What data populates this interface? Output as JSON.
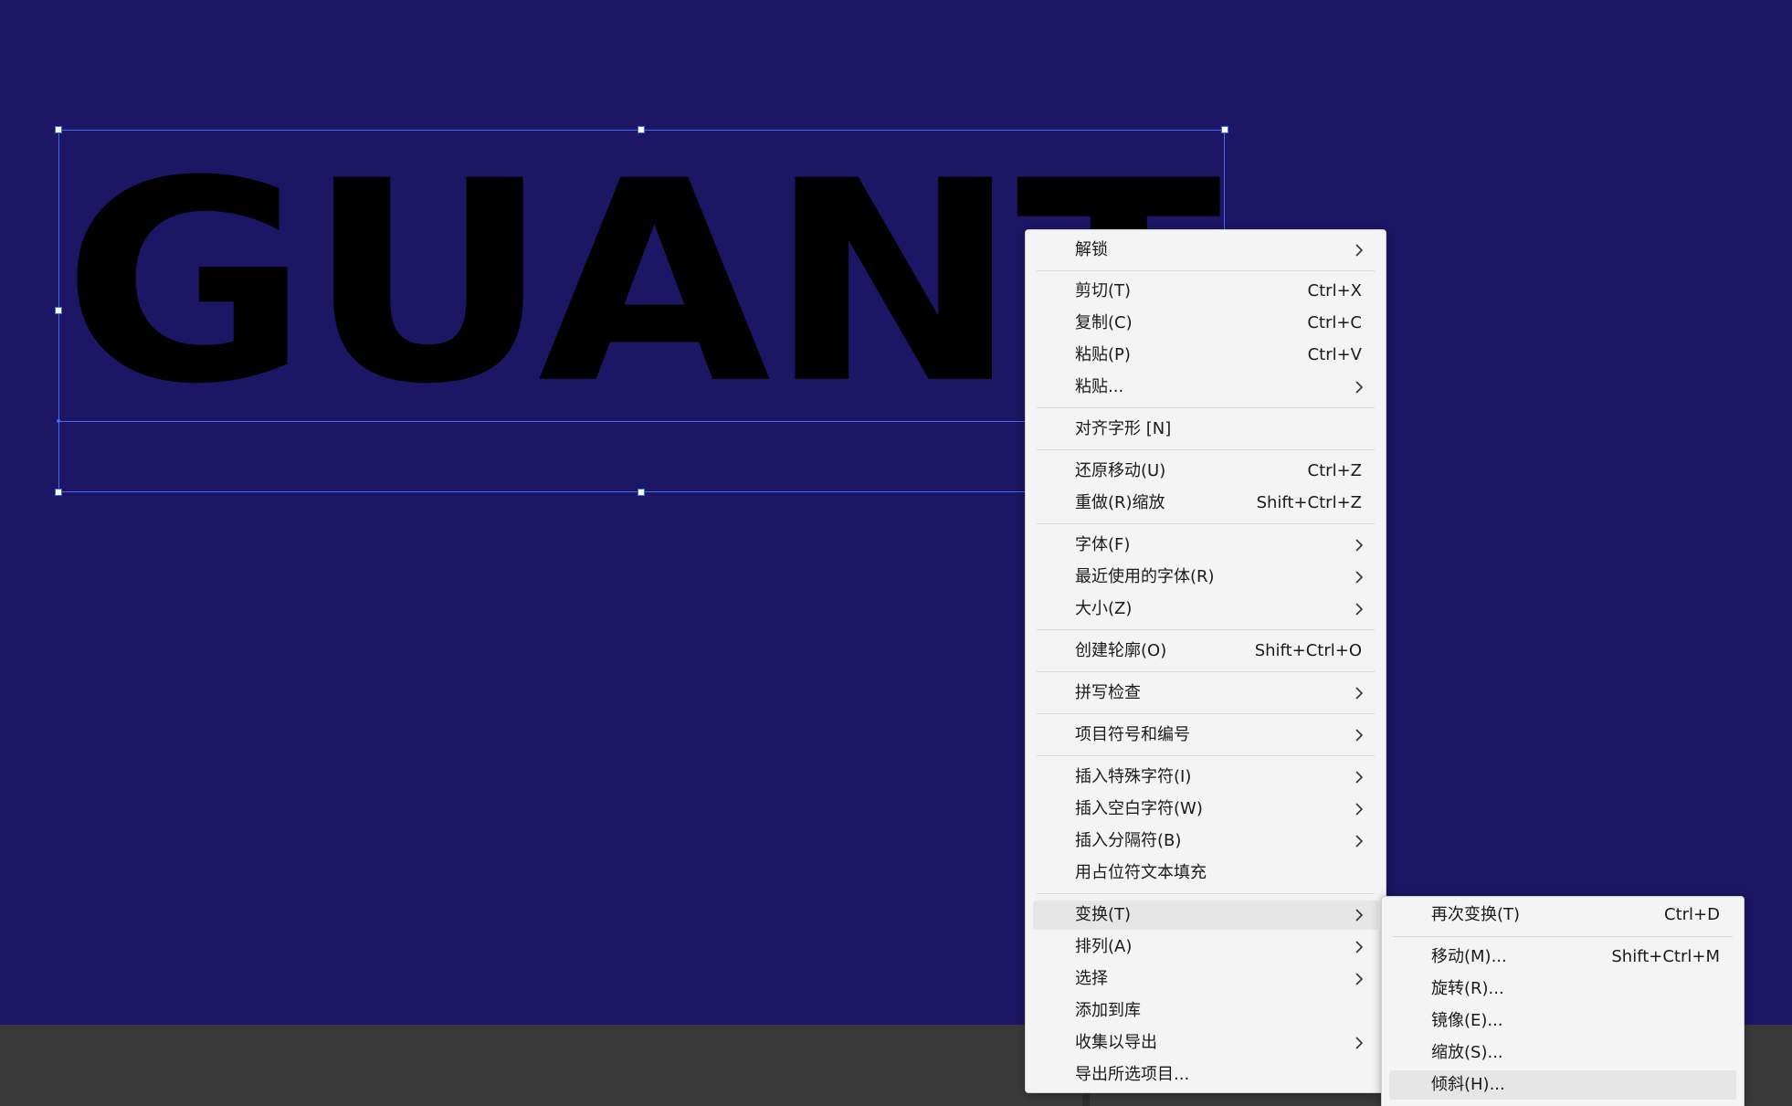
{
  "canvas": {
    "background_color": "#1c1664",
    "artwork_text": "GUANT",
    "selection_color": "#3d6cf2"
  },
  "context_menu": {
    "items": [
      {
        "label": "解锁",
        "submenu": true
      },
      {
        "label": "剪切(T)",
        "shortcut": "Ctrl+X"
      },
      {
        "label": "复制(C)",
        "shortcut": "Ctrl+C"
      },
      {
        "label": "粘贴(P)",
        "shortcut": "Ctrl+V"
      },
      {
        "label": "粘贴...",
        "submenu": true
      },
      {
        "label": "对齐字形 [N]"
      },
      {
        "label": "还原移动(U)",
        "shortcut": "Ctrl+Z"
      },
      {
        "label": "重做(R)缩放",
        "shortcut": "Shift+Ctrl+Z"
      },
      {
        "label": "字体(F)",
        "submenu": true
      },
      {
        "label": "最近使用的字体(R)",
        "submenu": true
      },
      {
        "label": "大小(Z)",
        "submenu": true
      },
      {
        "label": "创建轮廓(O)",
        "shortcut": "Shift+Ctrl+O"
      },
      {
        "label": "拼写检查",
        "submenu": true
      },
      {
        "label": "项目符号和编号",
        "submenu": true
      },
      {
        "label": "插入特殊字符(I)",
        "submenu": true
      },
      {
        "label": "插入空白字符(W)",
        "submenu": true
      },
      {
        "label": "插入分隔符(B)",
        "submenu": true
      },
      {
        "label": "用占位符文本填充"
      },
      {
        "label": "变换(T)",
        "submenu": true,
        "highlighted": true
      },
      {
        "label": "排列(A)",
        "submenu": true
      },
      {
        "label": "选择",
        "submenu": true
      },
      {
        "label": "添加到库"
      },
      {
        "label": "收集以导出",
        "submenu": true
      },
      {
        "label": "导出所选项目..."
      }
    ]
  },
  "transform_submenu": {
    "items": [
      {
        "label": "再次变换(T)",
        "shortcut": "Ctrl+D"
      },
      {
        "label": "移动(M)...",
        "shortcut": "Shift+Ctrl+M"
      },
      {
        "label": "旋转(R)..."
      },
      {
        "label": "镜像(E)..."
      },
      {
        "label": "缩放(S)..."
      },
      {
        "label": "倾斜(H)...",
        "highlighted": true
      }
    ]
  }
}
